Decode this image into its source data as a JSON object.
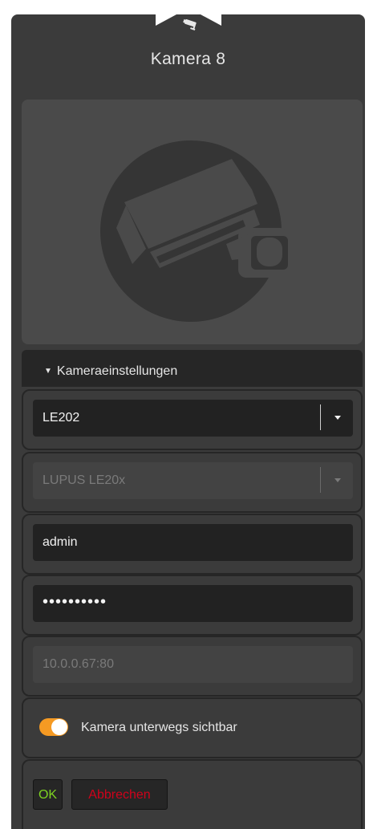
{
  "header": {
    "icon": "camera-icon",
    "title": "Kamera 8"
  },
  "preview": {
    "icon": "security-camera-icon"
  },
  "section": {
    "label": "Kameraeinstellungen",
    "expanded": true
  },
  "fields": {
    "model_select": {
      "value": "LE202"
    },
    "type_select": {
      "value": "LUPUS LE20x",
      "disabled": true
    },
    "username": {
      "value": "admin"
    },
    "password": {
      "value": "••••••••••"
    },
    "address": {
      "value": "10.0.0.67:80",
      "disabled": true
    }
  },
  "toggle": {
    "label": "Kamera unterwegs sichtbar",
    "on": true,
    "color": "#f59a23"
  },
  "buttons": {
    "ok": "OK",
    "cancel": "Abbrechen"
  },
  "colors": {
    "panel": "#3b3b3b",
    "field": "#222222",
    "ok": "#7ed321",
    "cancel": "#d0021b"
  }
}
